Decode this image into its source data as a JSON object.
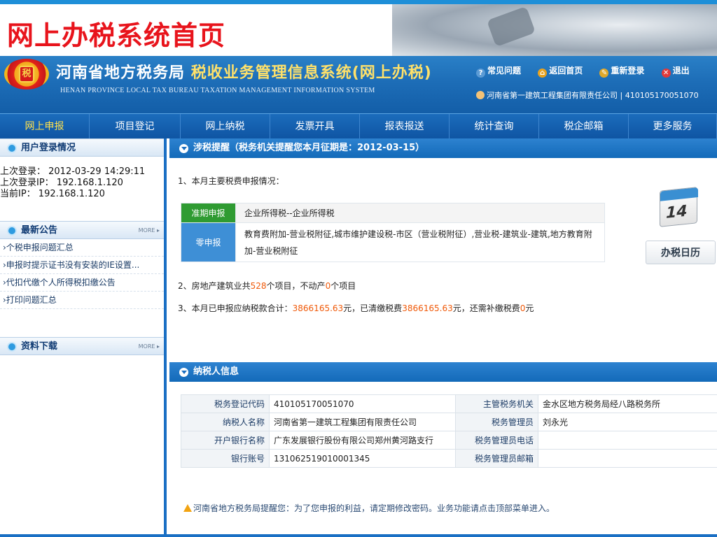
{
  "slide_title": "网上办税系统首页",
  "header": {
    "agency_name": "河南省地方税务局",
    "system_name": "税收业务管理信息系统(网上办税)",
    "english_name": "HENAN PROVINCE LOCAL TAX  BUREAU TAXATION MANAGEMENT INFORMATION SYSTEM",
    "logo_char": "税",
    "quick_links": [
      "常见问题",
      "返回首页",
      "重新登录",
      "退出"
    ],
    "user_info": "河南省第一建筑工程集团有限责任公司 | 410105170051070"
  },
  "nav": [
    "网上申报",
    "项目登记",
    "网上纳税",
    "发票开具",
    "报表报送",
    "统计查询",
    "税企邮箱",
    "更多服务"
  ],
  "left": {
    "login_title": "用户登录情况",
    "last_login": "上次登录： 2012-03-29 14:29:11",
    "last_ip": "上次登录IP： 192.168.1.120",
    "current_ip": "当前IP： 192.168.1.120",
    "notice_title": "最新公告",
    "more": "MORE",
    "notices": [
      "›个税申报问题汇总",
      "›申报时提示证书没有安装的IE设置...",
      "›代扣代缴个人所得税扣缴公告",
      "›打印问题汇总"
    ],
    "download_title": "资料下载"
  },
  "reminder": {
    "title": "涉税提醒（税务机关提醒您本月征期是：2012-03-15）",
    "line1": "1、本月主要税费申报情况：",
    "rows": [
      {
        "tag": "准期申报",
        "value": "企业所得税--企业所得税"
      },
      {
        "tag": "零申报",
        "value": "教育费附加-营业税附征,城市维护建设税-市区（营业税附征）,营业税-建筑业-建筑,地方教育附加-营业税附征"
      }
    ],
    "line2_pre": "2、房地产建筑业共",
    "line2_n1": "528",
    "line2_mid": "个项目，不动产",
    "line2_n2": "0",
    "line2_post": "个项目",
    "line3_pre": "3、本月已申报应纳税款合计：",
    "line3_n1": "3866165.63",
    "line3_mid": "元，已清缴税费",
    "line3_n2": "3866165.63",
    "line3_mid2": "元，还需补缴税费",
    "line3_n3": "0",
    "line3_post": "元",
    "calendar_day": "14",
    "calendar_button": "办税日历"
  },
  "taxpayer": {
    "title": "纳税人信息",
    "rows": [
      {
        "k1": "税务登记代码",
        "v1": "410105170051070",
        "k2": "主管税务机关",
        "v2": "金水区地方税务局经八路税务所"
      },
      {
        "k1": "纳税人名称",
        "v1": "河南省第一建筑工程集团有限责任公司",
        "k2": "税务管理员",
        "v2": "刘永光"
      },
      {
        "k1": "开户银行名称",
        "v1": "广东发展银行股份有限公司郑州黄河路支行",
        "k2": "税务管理员电话",
        "v2": ""
      },
      {
        "k1": "银行账号",
        "v1": "131062519010001345",
        "k2": "税务管理员邮箱",
        "v2": ""
      }
    ],
    "tip": "河南省地方税务局提醒您：为了您申报的利益，请定期修改密码。业务功能请点击顶部菜单进入。"
  }
}
